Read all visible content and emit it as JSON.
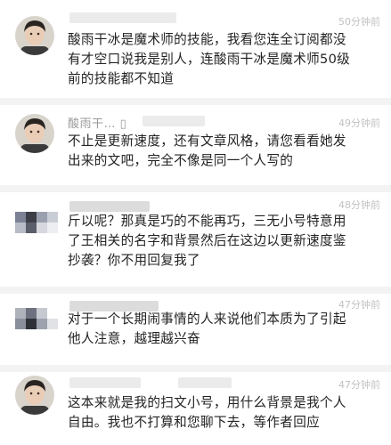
{
  "comments": [
    {
      "name": "",
      "time": "50分钟前",
      "content": "酸雨干冰是魔术师的技能，我看您连全订阅都没\n有才空口说我是别人，连酸雨干冰是魔术师50级\n前的技能都不知道",
      "avatar": "user-photo"
    },
    {
      "name": "酸雨干…  ▯",
      "time": "49分钟前",
      "content": "不止是更新速度，还有文章风格，请您看看她发\n出来的文吧，完全不像是同一个人写的",
      "avatar": "user-photo"
    },
    {
      "name": "",
      "time": "48分钟前",
      "content": "斤以呢？那真是巧的不能再巧，三无小号特意用\n了王相关的名字和背景然后在这边以更新速度鉴\n抄袭？你不用回复我了",
      "avatar": "pixelated"
    },
    {
      "name": "",
      "time": "47分钟前",
      "content": "对于一个长期闹事情的人来说他们本质为了引起\n他人注意，越理越兴奋",
      "avatar": "pixelated"
    },
    {
      "name": "",
      "time": "47分钟前",
      "content": "这本来就是我的扫文小号，用什么背景是我个人\n自由。我也不打算和您聊下去，等作者回应",
      "avatar": "user-photo"
    }
  ]
}
